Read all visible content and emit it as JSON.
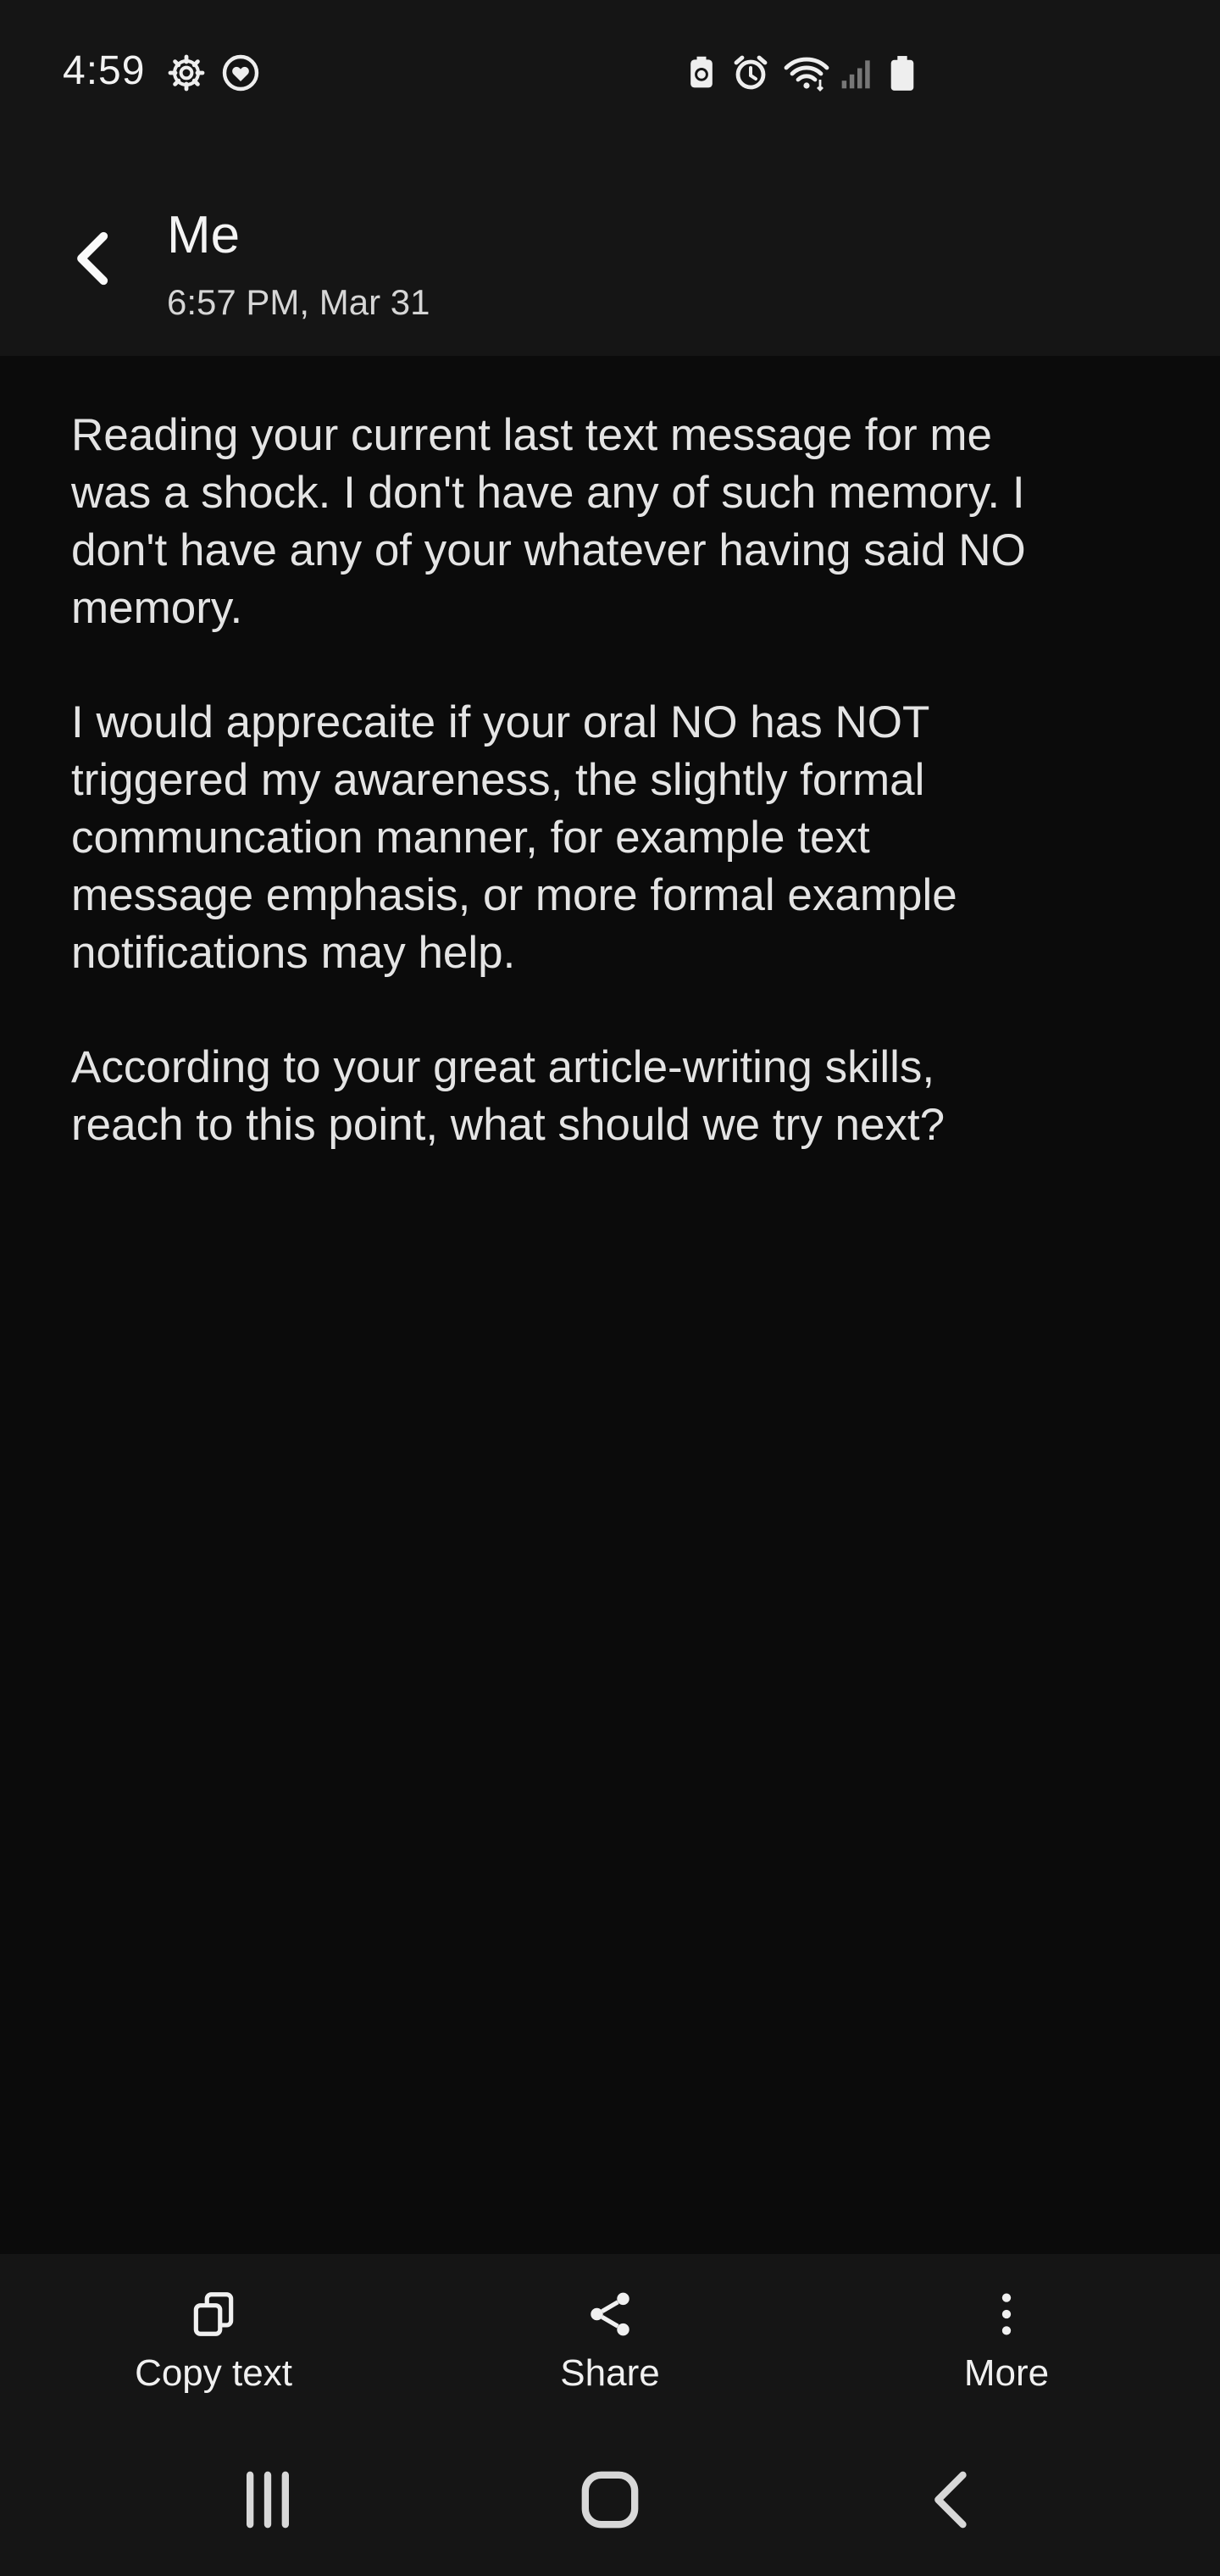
{
  "status_bar": {
    "time": "4:59",
    "icons": [
      "settings-gear-icon",
      "heart-shield-icon",
      "battery-saver-icon",
      "alarm-icon",
      "wifi-icon",
      "signal-icon",
      "battery-icon"
    ]
  },
  "header": {
    "title": "Me",
    "subtitle": "6:57 PM, Mar 31",
    "back_icon": "chevron-left-icon"
  },
  "message": {
    "paragraphs": [
      "Reading your current last text message for me\nwas a shock. I don't have any of such memory. I\ndon't have any of your whatever having said NO\nmemory.",
      "I would apprecaite if your oral NO has NOT\ntriggered my awareness, the slightly formal\ncommuncation manner, for example text\nmessage emphasis, or more formal example\nnotifications may help.",
      "According to your great article-writing skills,\nreach to this point, what should we try next?"
    ]
  },
  "actions": {
    "copy_label": "Copy text",
    "share_label": "Share",
    "more_label": "More"
  },
  "nav": {
    "icons": [
      "recent-apps-icon",
      "home-icon",
      "back-icon"
    ]
  },
  "colors": {
    "background": "#0b0b0b",
    "bar_background": "#151515",
    "text": "#e4e4e4"
  }
}
